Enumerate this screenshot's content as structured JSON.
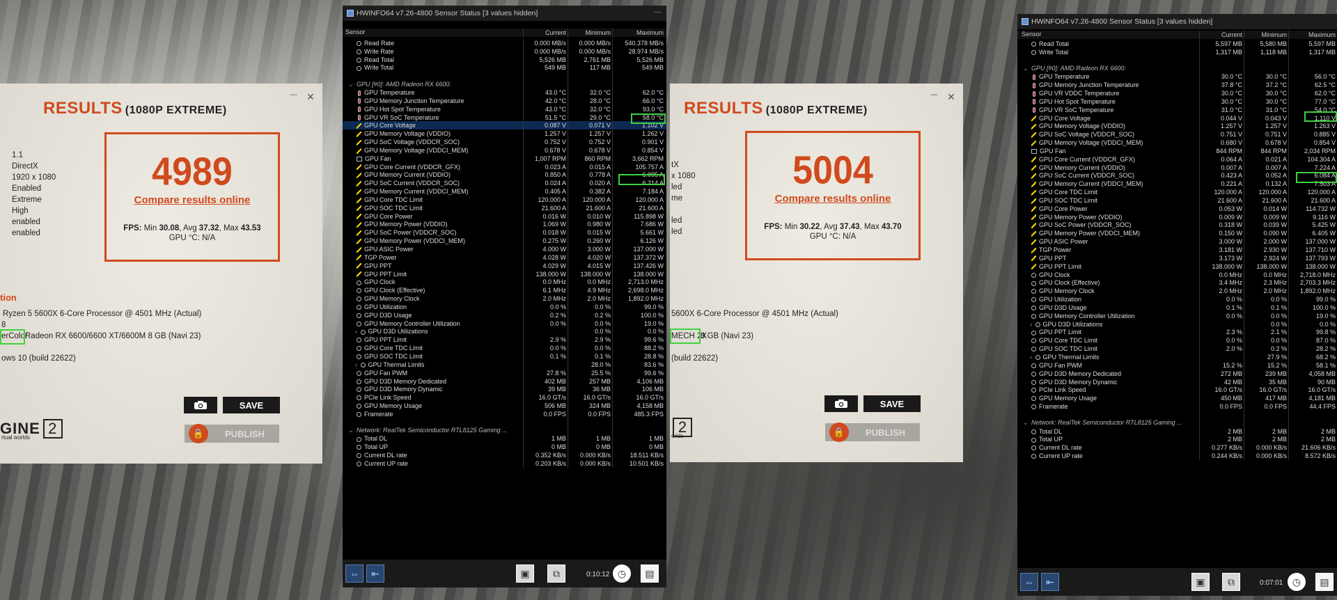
{
  "left_panel": {
    "title": "RESULTS",
    "subtitle": "(1080P EXTREME)",
    "score": "4989",
    "compare": "Compare results online",
    "fps_prefix": "FPS:",
    "fps_min_label": "Min",
    "fps_min": "30.08",
    "fps_avg_label": "Avg",
    "fps_avg": "37.32",
    "fps_max_label": "Max",
    "fps_max": "43.53",
    "gpu_temp": "GPU °C: N/A",
    "settings": [
      "1.1",
      "DirectX",
      "1920 x 1080",
      "Enabled",
      "Extreme",
      "High",
      "enabled",
      "enabled"
    ],
    "section_label": "tion",
    "cpu": "Ryzen 5 5600X 6-Core Processor @ 4501 MHz (Actual)",
    "gpu_cut": "8",
    "gpu_brand": "erColor",
    "gpu": "Radeon RX 6600/6600 XT/6600M 8 GB (Navi 23)",
    "os": "ows 10 (build 22622)",
    "save": "SAVE",
    "publish": "PUBLISH",
    "engine": "GINE",
    "engine_sub": "rtual worlds",
    "engine_num": "2",
    "close": "✕",
    "minimize": "—"
  },
  "right_panel": {
    "title": "RESULTS",
    "subtitle": "(1080P EXTREME)",
    "score": "5004",
    "compare": "Compare results online",
    "fps_prefix": "FPS:",
    "fps_min_label": "Min",
    "fps_min": "30.22",
    "fps_avg_label": "Avg",
    "fps_avg": "37.43",
    "fps_max_label": "Max",
    "fps_max": "43.70",
    "gpu_temp": "GPU °C: N/A",
    "settings": [
      "tX",
      "x 1080",
      "led",
      "me",
      "",
      "led",
      "led"
    ],
    "cpu": "5600X 6-Core Processor @ 4501 MHz (Actual)",
    "gpu_brand": "MECH 2X",
    "gpu": "8 GB (Navi 23)",
    "os": "(build 22622)",
    "save": "SAVE",
    "publish": "PUBLISH",
    "engine": "GINE",
    "engine_sub": "orlds",
    "engine_num": "2",
    "close": "✕",
    "minimize": "—"
  },
  "hw1": {
    "title": "HWiNFO64 v7.26-4800 Sensor Status [3 values hidden]",
    "headers": [
      "Sensor",
      "Current",
      "Minimum",
      "Maximum"
    ],
    "timer": "0:10:12",
    "rows": [
      {
        "n": "Read Rate",
        "c": "0.000 MB/s",
        "mi": "0.000 MB/s",
        "ma": "540.378 MB/s",
        "i": "o"
      },
      {
        "n": "Write Rate",
        "c": "0.000 MB/s",
        "mi": "0.000 MB/s",
        "ma": "28.974 MB/s",
        "i": "o"
      },
      {
        "n": "Read Total",
        "c": "5,526 MB",
        "mi": "2,761 MB",
        "ma": "5,526 MB",
        "i": "o"
      },
      {
        "n": "Write Total",
        "c": "549 MB",
        "mi": "117 MB",
        "ma": "549 MB",
        "i": "o"
      },
      {
        "n": "",
        "c": "",
        "mi": "",
        "ma": "",
        "i": ""
      },
      {
        "n": "GPU [#0]: AMD Radeon RX 6600:",
        "c": "",
        "mi": "",
        "ma": "",
        "i": "g"
      },
      {
        "n": "GPU Temperature",
        "c": "43.0 °C",
        "mi": "32.0 °C",
        "ma": "62.0 °C",
        "i": "t"
      },
      {
        "n": "GPU Memory Junction Temperature",
        "c": "42.0 °C",
        "mi": "28.0 °C",
        "ma": "66.0 °C",
        "i": "t"
      },
      {
        "n": "GPU Hot Spot Temperature",
        "c": "43.0 °C",
        "mi": "32.0 °C",
        "ma": "93.0 °C",
        "i": "t"
      },
      {
        "n": "GPU VR SoC Temperature",
        "c": "51.5 °C",
        "mi": "29.0 °C",
        "ma": "58.0 °C",
        "i": "t"
      },
      {
        "n": "GPU Core Voltage",
        "c": "0.087 V",
        "mi": "0.071 V",
        "ma": "1.102 V",
        "i": "b",
        "sel": true
      },
      {
        "n": "GPU Memory Voltage (VDDIO)",
        "c": "1.257 V",
        "mi": "1.257 V",
        "ma": "1.262 V",
        "i": "b"
      },
      {
        "n": "GPU SoC Voltage (VDDCR_SOC)",
        "c": "0.752 V",
        "mi": "0.752 V",
        "ma": "0.901 V",
        "i": "b"
      },
      {
        "n": "GPU Memory Voltage (VDDCI_MEM)",
        "c": "0.678 V",
        "mi": "0.678 V",
        "ma": "0.854 V",
        "i": "b"
      },
      {
        "n": "GPU Fan",
        "c": "1,007 RPM",
        "mi": "860 RPM",
        "ma": "3,662 RPM",
        "i": "f"
      },
      {
        "n": "GPU Core Current (VDDCR_GFX)",
        "c": "0.023 A",
        "mi": "0.015 A",
        "ma": "105.757 A",
        "i": "b"
      },
      {
        "n": "GPU Memory Current (VDDIO)",
        "c": "0.850 A",
        "mi": "0.778 A",
        "ma": "6.095 A",
        "i": "b"
      },
      {
        "n": "GPU SoC Current (VDDCR_SOC)",
        "c": "0.024 A",
        "mi": "0.020 A",
        "ma": "6.214 A",
        "i": "b"
      },
      {
        "n": "GPU Memory Current (VDDCI_MEM)",
        "c": "0.405 A",
        "mi": "0.382 A",
        "ma": "7.184 A",
        "i": "b"
      },
      {
        "n": "GPU Core TDC Limit",
        "c": "120.000 A",
        "mi": "120.000 A",
        "ma": "120.000 A",
        "i": "b"
      },
      {
        "n": "GPU SOC TDC Limit",
        "c": "21.600 A",
        "mi": "21.600 A",
        "ma": "21.600 A",
        "i": "b"
      },
      {
        "n": "GPU Core Power",
        "c": "0.016 W",
        "mi": "0.010 W",
        "ma": "115.898 W",
        "i": "b"
      },
      {
        "n": "GPU Memory Power (VDDIO)",
        "c": "1.069 W",
        "mi": "0.980 W",
        "ma": "7.686 W",
        "i": "b"
      },
      {
        "n": "GPU SoC Power (VDDCR_SOC)",
        "c": "0.018 W",
        "mi": "0.015 W",
        "ma": "5.661 W",
        "i": "b"
      },
      {
        "n": "GPU Memory Power (VDDCI_MEM)",
        "c": "0.275 W",
        "mi": "0.260 W",
        "ma": "6.126 W",
        "i": "b"
      },
      {
        "n": "GPU ASIC Power",
        "c": "4.000 W",
        "mi": "3.000 W",
        "ma": "137.000 W",
        "i": "b"
      },
      {
        "n": "TGP Power",
        "c": "4.028 W",
        "mi": "4.020 W",
        "ma": "137.372 W",
        "i": "b"
      },
      {
        "n": "GPU PPT",
        "c": "4.029 W",
        "mi": "4.015 W",
        "ma": "137.426 W",
        "i": "b"
      },
      {
        "n": "GPU PPT Limit",
        "c": "138.000 W",
        "mi": "138.000 W",
        "ma": "138.000 W",
        "i": "b"
      },
      {
        "n": "GPU Clock",
        "c": "0.0 MHz",
        "mi": "0.0 MHz",
        "ma": "2,713.0 MHz",
        "i": "o"
      },
      {
        "n": "GPU Clock (Effective)",
        "c": "6.1 MHz",
        "mi": "4.9 MHz",
        "ma": "2,698.0 MHz",
        "i": "o"
      },
      {
        "n": "GPU Memory Clock",
        "c": "2.0 MHz",
        "mi": "2.0 MHz",
        "ma": "1,892.0 MHz",
        "i": "o"
      },
      {
        "n": "GPU Utilization",
        "c": "0.0 %",
        "mi": "0.0 %",
        "ma": "99.0 %",
        "i": "o"
      },
      {
        "n": "GPU D3D Usage",
        "c": "0.2 %",
        "mi": "0.2 %",
        "ma": "100.0 %",
        "i": "o"
      },
      {
        "n": "GPU Memory Controller Utilization",
        "c": "0.0 %",
        "mi": "0.0 %",
        "ma": "19.0 %",
        "i": "o"
      },
      {
        "n": "GPU D3D Utilizations",
        "c": "",
        "mi": "0.0 %",
        "ma": "0.0 %",
        "i": "o",
        "sub": true
      },
      {
        "n": "GPU PPT Limit",
        "c": "2.9 %",
        "mi": "2.9 %",
        "ma": "99.6 %",
        "i": "o"
      },
      {
        "n": "GPU Core TDC Limit",
        "c": "0.0 %",
        "mi": "0.0 %",
        "ma": "88.2 %",
        "i": "o"
      },
      {
        "n": "GPU SOC TDC Limit",
        "c": "0.1 %",
        "mi": "0.1 %",
        "ma": "28.8 %",
        "i": "o"
      },
      {
        "n": "GPU Thermal Limits",
        "c": "",
        "mi": "28.0 %",
        "ma": "83.6 %",
        "i": "o",
        "sub": true
      },
      {
        "n": "GPU Fan PWM",
        "c": "27.8 %",
        "mi": "25.5 %",
        "ma": "99.6 %",
        "i": "o"
      },
      {
        "n": "GPU D3D Memory Dedicated",
        "c": "402 MB",
        "mi": "257 MB",
        "ma": "4,106 MB",
        "i": "o"
      },
      {
        "n": "GPU D3D Memory Dynamic",
        "c": "39 MB",
        "mi": "36 MB",
        "ma": "106 MB",
        "i": "o"
      },
      {
        "n": "PCIe Link Speed",
        "c": "16.0 GT/s",
        "mi": "16.0 GT/s",
        "ma": "16.0 GT/s",
        "i": "o"
      },
      {
        "n": "GPU Memory Usage",
        "c": "506 MB",
        "mi": "324 MB",
        "ma": "4,158 MB",
        "i": "o"
      },
      {
        "n": "Framerate",
        "c": "0.0 FPS",
        "mi": "0.0 FPS",
        "ma": "485.3 FPS",
        "i": "o"
      },
      {
        "n": "",
        "c": "",
        "mi": "",
        "ma": "",
        "i": ""
      },
      {
        "n": "Network: RealTek Semiconductor RTL8125 Gaming ...",
        "c": "",
        "mi": "",
        "ma": "",
        "i": "g"
      },
      {
        "n": "Total DL",
        "c": "1 MB",
        "mi": "1 MB",
        "ma": "1 MB",
        "i": "o"
      },
      {
        "n": "Total UP",
        "c": "0 MB",
        "mi": "0 MB",
        "ma": "0 MB",
        "i": "o"
      },
      {
        "n": "Current DL rate",
        "c": "0.352 KB/s",
        "mi": "0.000 KB/s",
        "ma": "18.511 KB/s",
        "i": "o"
      },
      {
        "n": "Current UP rate",
        "c": "0.203 KB/s",
        "mi": "0.000 KB/s",
        "ma": "10.501 KB/s",
        "i": "o"
      }
    ]
  },
  "hw2": {
    "title": "HWiNFO64 v7.26-4800 Sensor Status [3 values hidden]",
    "headers": [
      "Sensor",
      "Current",
      "Minimum",
      "Maximum"
    ],
    "timer": "0:07:01",
    "rows": [
      {
        "n": "Read Total",
        "c": "5,597 MB",
        "mi": "5,580 MB",
        "ma": "5,597 MB",
        "i": "o"
      },
      {
        "n": "Write Total",
        "c": "1,317 MB",
        "mi": "1,118 MB",
        "ma": "1,317 MB",
        "i": "o"
      },
      {
        "n": "",
        "c": "",
        "mi": "",
        "ma": "",
        "i": ""
      },
      {
        "n": "GPU [#0]: AMD Radeon RX 6600:",
        "c": "",
        "mi": "",
        "ma": "",
        "i": "g"
      },
      {
        "n": "GPU Temperature",
        "c": "30.0 °C",
        "mi": "30.0 °C",
        "ma": "56.0 °C",
        "i": "t"
      },
      {
        "n": "GPU Memory Junction Temperature",
        "c": "37.8 °C",
        "mi": "37.2 °C",
        "ma": "62.5 °C",
        "i": "t"
      },
      {
        "n": "GPU VR VDDC Temperature",
        "c": "30.0 °C",
        "mi": "30.0 °C",
        "ma": "62.0 °C",
        "i": "t"
      },
      {
        "n": "GPU Hot Spot Temperature",
        "c": "30.0 °C",
        "mi": "30.0 °C",
        "ma": "77.0 °C",
        "i": "t"
      },
      {
        "n": "GPU VR SoC Temperature",
        "c": "31.0 °C",
        "mi": "31.0 °C",
        "ma": "54.0 °C",
        "i": "t"
      },
      {
        "n": "GPU Core Voltage",
        "c": "0.044 V",
        "mi": "0.043 V",
        "ma": "1.110 V",
        "i": "b"
      },
      {
        "n": "GPU Memory Voltage (VDDIO)",
        "c": "1.257 V",
        "mi": "1.257 V",
        "ma": "1.263 V",
        "i": "b"
      },
      {
        "n": "GPU SoC Voltage (VDDCR_SOC)",
        "c": "0.751 V",
        "mi": "0.751 V",
        "ma": "0.885 V",
        "i": "b"
      },
      {
        "n": "GPU Memory Voltage (VDDCI_MEM)",
        "c": "0.680 V",
        "mi": "0.678 V",
        "ma": "0.854 V",
        "i": "b"
      },
      {
        "n": "GPU Fan",
        "c": "844 RPM",
        "mi": "844 RPM",
        "ma": "2,034 RPM",
        "i": "f"
      },
      {
        "n": "GPU Core Current (VDDCR_GFX)",
        "c": "0.064 A",
        "mi": "0.021 A",
        "ma": "104.304 A",
        "i": "b"
      },
      {
        "n": "GPU Memory Current (VDDIO)",
        "c": "0.007 A",
        "mi": "0.007 A",
        "ma": "7.224 A",
        "i": "b"
      },
      {
        "n": "GPU SoC Current (VDDCR_SOC)",
        "c": "0.423 A",
        "mi": "0.052 A",
        "ma": "6.084 A",
        "i": "b"
      },
      {
        "n": "GPU Memory Current (VDDCI_MEM)",
        "c": "0.221 A",
        "mi": "0.132 A",
        "ma": "7.503 A",
        "i": "b"
      },
      {
        "n": "GPU Core TDC Limit",
        "c": "120.000 A",
        "mi": "120.000 A",
        "ma": "120.000 A",
        "i": "b"
      },
      {
        "n": "GPU SOC TDC Limit",
        "c": "21.600 A",
        "mi": "21.600 A",
        "ma": "21.600 A",
        "i": "b"
      },
      {
        "n": "GPU Core Power",
        "c": "0.053 W",
        "mi": "0.014 W",
        "ma": "114.732 W",
        "i": "b"
      },
      {
        "n": "GPU Memory Power (VDDIO)",
        "c": "0.009 W",
        "mi": "0.009 W",
        "ma": "9.116 W",
        "i": "b"
      },
      {
        "n": "GPU SoC Power (VDDCR_SOC)",
        "c": "0.318 W",
        "mi": "0.039 W",
        "ma": "5.425 W",
        "i": "b"
      },
      {
        "n": "GPU Memory Power (VDDCI_MEM)",
        "c": "0.150 W",
        "mi": "0.090 W",
        "ma": "6.405 W",
        "i": "b"
      },
      {
        "n": "GPU ASIC Power",
        "c": "3.000 W",
        "mi": "2.000 W",
        "ma": "137.000 W",
        "i": "b"
      },
      {
        "n": "TGP Power",
        "c": "3.181 W",
        "mi": "2.930 W",
        "ma": "137.710 W",
        "i": "b"
      },
      {
        "n": "GPU PPT",
        "c": "3.173 W",
        "mi": "2.924 W",
        "ma": "137.793 W",
        "i": "b"
      },
      {
        "n": "GPU PPT Limit",
        "c": "138.000 W",
        "mi": "138.000 W",
        "ma": "138.000 W",
        "i": "b"
      },
      {
        "n": "GPU Clock",
        "c": "0.0 MHz",
        "mi": "0.0 MHz",
        "ma": "2,718.0 MHz",
        "i": "o"
      },
      {
        "n": "GPU Clock (Effective)",
        "c": "3.4 MHz",
        "mi": "2.3 MHz",
        "ma": "2,703.3 MHz",
        "i": "o"
      },
      {
        "n": "GPU Memory Clock",
        "c": "2.0 MHz",
        "mi": "2.0 MHz",
        "ma": "1,892.0 MHz",
        "i": "o"
      },
      {
        "n": "GPU Utilization",
        "c": "0.0 %",
        "mi": "0.0 %",
        "ma": "99.0 %",
        "i": "o"
      },
      {
        "n": "GPU D3D Usage",
        "c": "0.1 %",
        "mi": "0.1 %",
        "ma": "100.0 %",
        "i": "o"
      },
      {
        "n": "GPU Memory Controller Utilization",
        "c": "0.0 %",
        "mi": "0.0 %",
        "ma": "19.0 %",
        "i": "o"
      },
      {
        "n": "GPU D3D Utilizations",
        "c": "",
        "mi": "0.0 %",
        "ma": "0.0 %",
        "i": "o",
        "sub": true
      },
      {
        "n": "GPU PPT Limit",
        "c": "2.3 %",
        "mi": "2.1 %",
        "ma": "99.8 %",
        "i": "o"
      },
      {
        "n": "GPU Core TDC Limit",
        "c": "0.0 %",
        "mi": "0.0 %",
        "ma": "87.0 %",
        "i": "o"
      },
      {
        "n": "GPU SOC TDC Limit",
        "c": "2.0 %",
        "mi": "0.2 %",
        "ma": "28.2 %",
        "i": "o"
      },
      {
        "n": "GPU Thermal Limits",
        "c": "",
        "mi": "27.9 %",
        "ma": "68.2 %",
        "i": "o",
        "sub": true
      },
      {
        "n": "GPU Fan PWM",
        "c": "15.2 %",
        "mi": "15.2 %",
        "ma": "58.1 %",
        "i": "o"
      },
      {
        "n": "GPU D3D Memory Dedicated",
        "c": "272 MB",
        "mi": "239 MB",
        "ma": "4,058 MB",
        "i": "o"
      },
      {
        "n": "GPU D3D Memory Dynamic",
        "c": "42 MB",
        "mi": "35 MB",
        "ma": "90 MB",
        "i": "o"
      },
      {
        "n": "PCIe Link Speed",
        "c": "16.0 GT/s",
        "mi": "16.0 GT/s",
        "ma": "16.0 GT/s",
        "i": "o"
      },
      {
        "n": "GPU Memory Usage",
        "c": "450 MB",
        "mi": "417 MB",
        "ma": "4,181 MB",
        "i": "o"
      },
      {
        "n": "Framerate",
        "c": "0.0 FPS",
        "mi": "0.0 FPS",
        "ma": "44.4 FPS",
        "i": "o"
      },
      {
        "n": "",
        "c": "",
        "mi": "",
        "ma": "",
        "i": ""
      },
      {
        "n": "Network: RealTek Semiconductor RTL8125 Gaming ...",
        "c": "",
        "mi": "",
        "ma": "",
        "i": "g"
      },
      {
        "n": "Total DL",
        "c": "2 MB",
        "mi": "2 MB",
        "ma": "2 MB",
        "i": "o"
      },
      {
        "n": "Total UP",
        "c": "2 MB",
        "mi": "2 MB",
        "ma": "2 MB",
        "i": "o"
      },
      {
        "n": "Current DL rate",
        "c": "0.277 KB/s",
        "mi": "0.000 KB/s",
        "ma": "21.606 KB/s",
        "i": "o"
      },
      {
        "n": "Current UP rate",
        "c": "0.244 KB/s",
        "mi": "0.000 KB/s",
        "ma": "8.572 KB/s",
        "i": "o"
      }
    ]
  }
}
